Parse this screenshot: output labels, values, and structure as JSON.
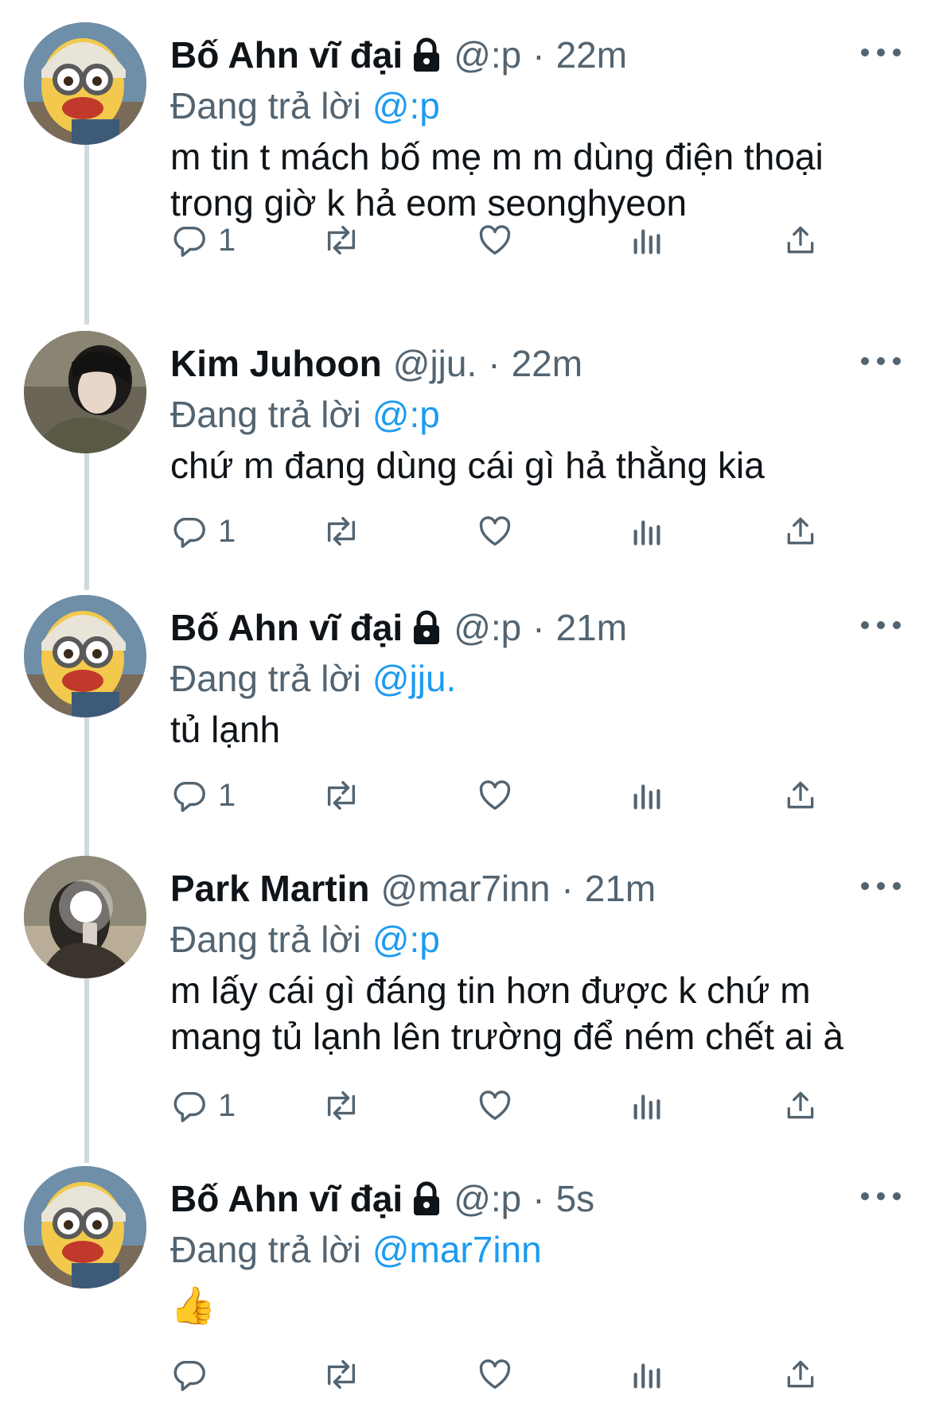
{
  "reply_prefix": "Đang trả lời",
  "tweets": [
    {
      "author": "Bố Ahn vĩ đại",
      "locked": true,
      "handle": "@:p",
      "separator": "·",
      "time": "22m",
      "replying_to": "@:p",
      "text": "m tin t mách bố mẹ m m dùng điện thoại trong giờ k hả eom seonghyeon",
      "reply_count": "1"
    },
    {
      "author": "Kim Juhoon",
      "locked": false,
      "handle": "@jju.",
      "separator": "·",
      "time": "22m",
      "replying_to": "@:p",
      "text": "chứ m đang dùng cái gì hả thằng kia",
      "reply_count": "1"
    },
    {
      "author": "Bố Ahn vĩ đại",
      "locked": true,
      "handle": "@:p",
      "separator": "·",
      "time": "21m",
      "replying_to": "@jju.",
      "text": "tủ lạnh",
      "reply_count": "1"
    },
    {
      "author": "Park Martin",
      "locked": false,
      "handle": "@mar7inn",
      "separator": "·",
      "time": "21m",
      "replying_to": "@:p",
      "text": "m lấy cái gì đáng tin hơn được k chứ m mang tủ lạnh lên trường để ném chết ai à",
      "reply_count": "1"
    },
    {
      "author": "Bố Ahn vĩ đại",
      "locked": true,
      "handle": "@:p",
      "separator": "·",
      "time": "5s",
      "replying_to": "@mar7inn",
      "text": "👍",
      "reply_count": ""
    }
  ],
  "icons": {
    "reply": "reply-icon",
    "retweet": "retweet-icon",
    "like": "heart-icon",
    "views": "views-icon",
    "share": "share-icon",
    "more": "more-icon",
    "lock": "lock-icon"
  },
  "colors": {
    "text": "#0f1419",
    "secondary": "#536471",
    "link": "#1d9bf0",
    "thread_line": "#cfd9de"
  }
}
